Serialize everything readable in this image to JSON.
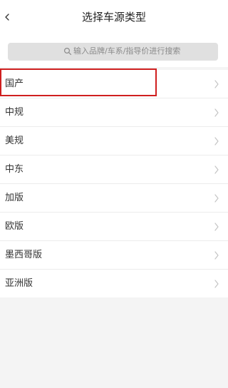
{
  "header": {
    "title": "选择车源类型",
    "back_icon": "chevron-left-icon"
  },
  "search": {
    "placeholder": "输入品牌/车系/指导价进行搜索",
    "icon": "search-icon"
  },
  "categories": [
    {
      "label": "国产",
      "selected": true
    },
    {
      "label": "中规"
    },
    {
      "label": "美规"
    },
    {
      "label": "中东"
    },
    {
      "label": "加版"
    },
    {
      "label": "欧版"
    },
    {
      "label": "墨西哥版"
    },
    {
      "label": "亚洲版"
    }
  ],
  "colors": {
    "highlight_border": "#cf1f1f",
    "background": "#f4f4f4",
    "search_box": "#e0e0e0"
  }
}
